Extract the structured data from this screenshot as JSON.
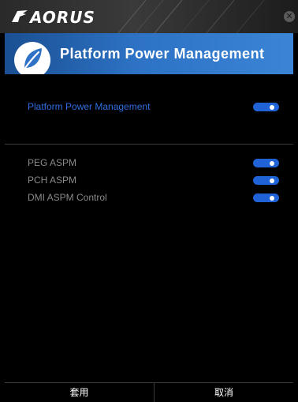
{
  "brand": {
    "name": "AORUS",
    "colors": {
      "bar": "#2e2e2e",
      "text": "#ffffff"
    }
  },
  "header": {
    "title": "Platform Power Management",
    "icon": "leaf-icon",
    "colors": {
      "start": "#1a4f92",
      "end": "#3b84d6"
    }
  },
  "settings": {
    "primary": {
      "label": "Platform Power Management",
      "enabled": true
    },
    "items": [
      {
        "label": "PEG ASPM",
        "enabled": true
      },
      {
        "label": "PCH ASPM",
        "enabled": true
      },
      {
        "label": "DMI ASPM Control",
        "enabled": true
      }
    ]
  },
  "footer": {
    "apply_label": "套用",
    "cancel_label": "取消"
  },
  "accent_color": "#1f63d6"
}
